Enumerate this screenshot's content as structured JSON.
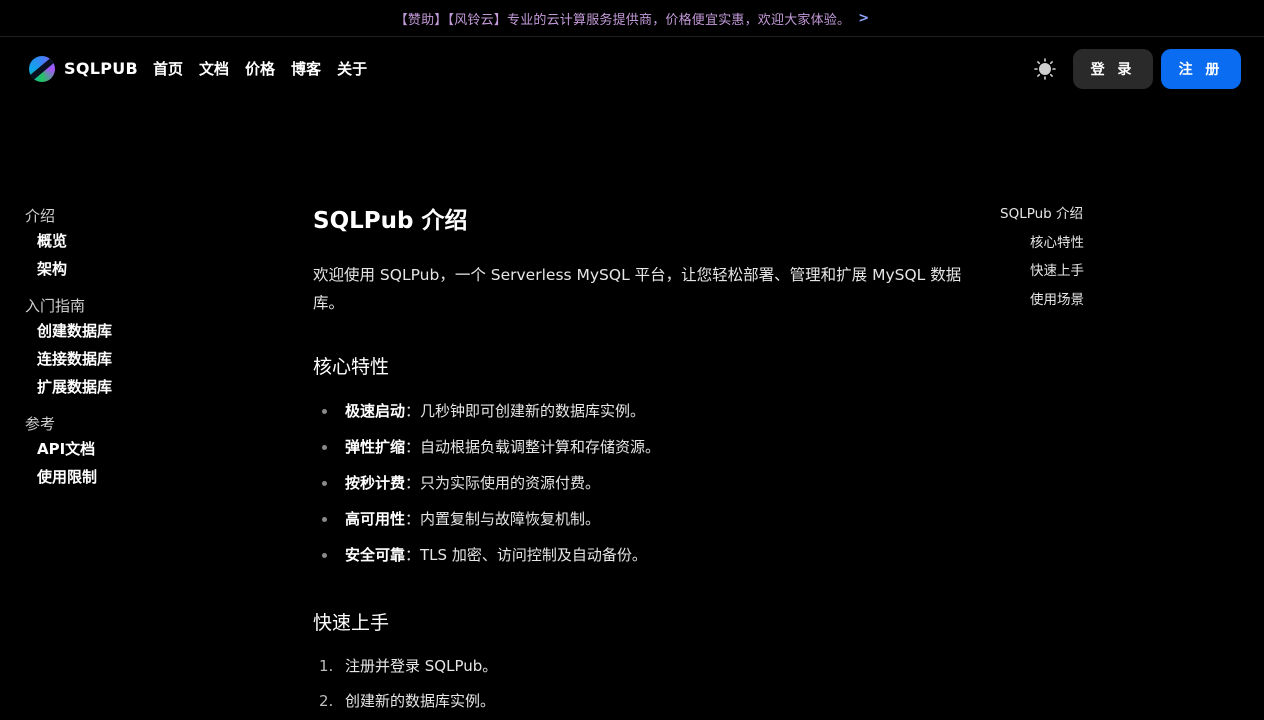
{
  "announcement": {
    "text": "【赞助】【风铃云】专业的云计算服务提供商，价格便宜实惠，欢迎大家体验。",
    "arrow": ">"
  },
  "header": {
    "brand": "SQLPUB",
    "nav": [
      "首页",
      "文档",
      "价格",
      "博客",
      "关于"
    ],
    "theme_icon": "sun-icon",
    "login_label": "登 录",
    "register_label": "注 册",
    "accent_color": "#0a6cf0"
  },
  "sidebar": {
    "groups": [
      {
        "title": "介绍",
        "items": [
          "概览",
          "架构"
        ]
      },
      {
        "title": "入门指南",
        "items": [
          "创建数据库",
          "连接数据库",
          "扩展数据库"
        ]
      },
      {
        "title": "参考",
        "items": [
          "API文档",
          "使用限制"
        ]
      }
    ]
  },
  "main": {
    "title": "SQLPub 介绍",
    "intro": "欢迎使用 SQLPub，一个 Serverless MySQL 平台，让您轻松部署、管理和扩展 MySQL 数据库。",
    "features_heading": "核心特性",
    "features": [
      {
        "name": "极速启动",
        "desc": "：几秒钟即可创建新的数据库实例。"
      },
      {
        "name": "弹性扩缩",
        "desc": "：自动根据负载调整计算和存储资源。"
      },
      {
        "name": "按秒计费",
        "desc": "：只为实际使用的资源付费。"
      },
      {
        "name": "高可用性",
        "desc": "：内置复制与故障恢复机制。"
      },
      {
        "name": "安全可靠",
        "desc": "：TLS 加密、访问控制及自动备份。"
      }
    ],
    "quickstart_heading": "快速上手",
    "steps": [
      "注册并登录 SQLPub。",
      "创建新的数据库实例。"
    ]
  },
  "toc": {
    "title": "SQLPub 介绍",
    "items": [
      "核心特性",
      "快速上手",
      "使用场景"
    ]
  }
}
